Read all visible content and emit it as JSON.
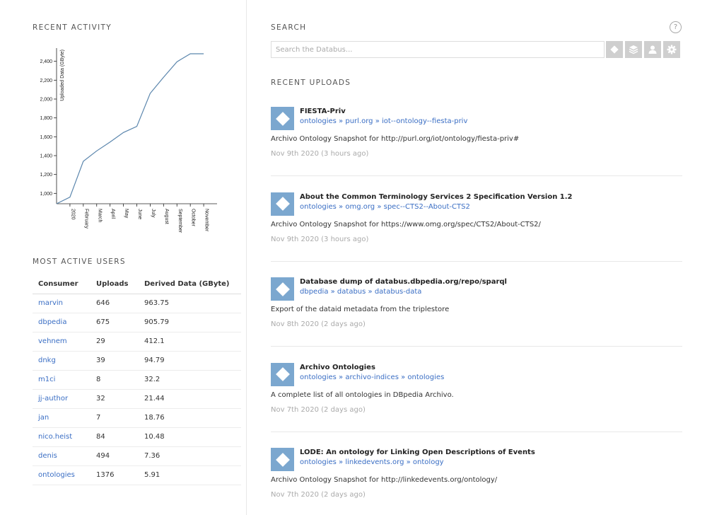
{
  "recent_activity": {
    "heading": "RECENT ACTIVITY"
  },
  "chart_data": {
    "type": "line",
    "ylabel": "Uploaded Data (GByte)",
    "y_ticks": [
      "1,000",
      "1,200",
      "1,400",
      "1,600",
      "1,800",
      "2,000",
      "2,200",
      "2,400"
    ],
    "ylim": [
      890,
      2540
    ],
    "x_ticks": [
      "2020",
      "February",
      "March",
      "April",
      "May",
      "June",
      "July",
      "August",
      "September",
      "October",
      "November"
    ],
    "x_domain": [
      -1,
      11
    ],
    "series": [
      {
        "x": [
          -1,
          0,
          1,
          2,
          3,
          4,
          5,
          6,
          7,
          8,
          9,
          10
        ],
        "y": [
          890,
          960,
          1340,
          1450,
          1545,
          1645,
          1710,
          2060,
          2230,
          2395,
          2480,
          2480
        ]
      }
    ],
    "grid": false,
    "color": "#5b86ad"
  },
  "users": {
    "heading": "MOST ACTIVE USERS",
    "columns": [
      "Consumer",
      "Uploads",
      "Derived Data (GByte)"
    ],
    "rows": [
      {
        "name": "marvin",
        "uploads": "646",
        "data": "963.75"
      },
      {
        "name": "dbpedia",
        "uploads": "675",
        "data": "905.79"
      },
      {
        "name": "vehnem",
        "uploads": "29",
        "data": "412.1"
      },
      {
        "name": "dnkg",
        "uploads": "39",
        "data": "94.79"
      },
      {
        "name": "m1ci",
        "uploads": "8",
        "data": "32.2"
      },
      {
        "name": "jj-author",
        "uploads": "32",
        "data": "21.44"
      },
      {
        "name": "jan",
        "uploads": "7",
        "data": "18.76"
      },
      {
        "name": "nico.heist",
        "uploads": "84",
        "data": "10.48"
      },
      {
        "name": "denis",
        "uploads": "494",
        "data": "7.36"
      },
      {
        "name": "ontologies",
        "uploads": "1376",
        "data": "5.91"
      }
    ]
  },
  "search": {
    "heading": "SEARCH",
    "help": "?",
    "placeholder": "Search the Databus...",
    "icons": [
      "diamond-icon",
      "layers-icon",
      "user-icon",
      "gear-icon"
    ]
  },
  "uploads": {
    "heading": "RECENT UPLOADS",
    "items": [
      {
        "title": "FIESTA-Priv",
        "path": "ontologies » purl.org » iot--ontology--fiesta-priv",
        "description": "Archivo Ontology Snapshot for http://purl.org/iot/ontology/fiesta-priv#",
        "date": "Nov 9th 2020 (3 hours ago)"
      },
      {
        "title": "About the Common Terminology Services 2 Specification Version 1.2",
        "path": "ontologies » omg.org » spec--CTS2--About-CTS2",
        "description": "Archivo Ontology Snapshot for https://www.omg.org/spec/CTS2/About-CTS2/",
        "date": "Nov 9th 2020 (3 hours ago)"
      },
      {
        "title": "Database dump of databus.dbpedia.org/repo/sparql",
        "path": "dbpedia » databus » databus-data",
        "description": "Export of the dataid metadata from the triplestore",
        "date": "Nov 8th 2020 (2 days ago)"
      },
      {
        "title": "Archivo Ontologies",
        "path": "ontologies » archivo-indices » ontologies",
        "description": "A complete list of all ontologies in DBpedia Archivo.",
        "date": "Nov 7th 2020 (2 days ago)"
      },
      {
        "title": "LODE: An ontology for Linking Open Descriptions of Events",
        "path": "ontologies » linkedevents.org » ontology",
        "description": "Archivo Ontology Snapshot for http://linkedevents.org/ontology/",
        "date": "Nov 7th 2020 (2 days ago)"
      }
    ]
  }
}
